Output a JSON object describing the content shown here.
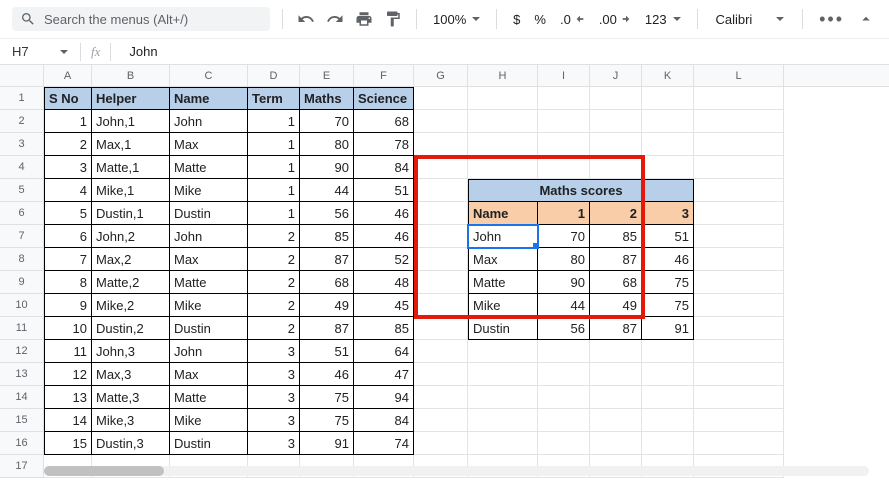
{
  "toolbar": {
    "search_placeholder": "Search the menus (Alt+/)",
    "zoom": "100%",
    "currency": "$",
    "percent": "%",
    "dec_dec": ".0",
    "inc_dec": ".00",
    "fmt123": "123",
    "font": "Calibri",
    "more": "•••"
  },
  "formula_bar": {
    "cell_ref": "H7",
    "fx": "fx",
    "value": "John"
  },
  "columns": [
    "A",
    "B",
    "C",
    "D",
    "E",
    "F",
    "G",
    "H",
    "I",
    "J",
    "K",
    "L"
  ],
  "main_headers": [
    "S No",
    "Helper",
    "Name",
    "Term",
    "Maths",
    "Science"
  ],
  "main_rows": [
    [
      "1",
      "John,1",
      "John",
      "1",
      "70",
      "68"
    ],
    [
      "2",
      "Max,1",
      "Max",
      "1",
      "80",
      "78"
    ],
    [
      "3",
      "Matte,1",
      "Matte",
      "1",
      "90",
      "84"
    ],
    [
      "4",
      "Mike,1",
      "Mike",
      "1",
      "44",
      "51"
    ],
    [
      "5",
      "Dustin,1",
      "Dustin",
      "1",
      "56",
      "46"
    ],
    [
      "6",
      "John,2",
      "John",
      "2",
      "85",
      "46"
    ],
    [
      "7",
      "Max,2",
      "Max",
      "2",
      "87",
      "52"
    ],
    [
      "8",
      "Matte,2",
      "Matte",
      "2",
      "68",
      "48"
    ],
    [
      "9",
      "Mike,2",
      "Mike",
      "2",
      "49",
      "45"
    ],
    [
      "10",
      "Dustin,2",
      "Dustin",
      "2",
      "87",
      "85"
    ],
    [
      "11",
      "John,3",
      "John",
      "3",
      "51",
      "64"
    ],
    [
      "12",
      "Max,3",
      "Max",
      "3",
      "46",
      "47"
    ],
    [
      "13",
      "Matte,3",
      "Matte",
      "3",
      "75",
      "94"
    ],
    [
      "14",
      "Mike,3",
      "Mike",
      "3",
      "75",
      "84"
    ],
    [
      "15",
      "Dustin,3",
      "Dustin",
      "3",
      "91",
      "74"
    ]
  ],
  "side_table": {
    "title": "Maths scores",
    "col_headers": [
      "Name",
      "1",
      "2",
      "3"
    ],
    "rows": [
      [
        "John",
        "70",
        "85",
        "51"
      ],
      [
        "Max",
        "80",
        "87",
        "46"
      ],
      [
        "Matte",
        "90",
        "68",
        "75"
      ],
      [
        "Mike",
        "44",
        "49",
        "75"
      ],
      [
        "Dustin",
        "56",
        "87",
        "91"
      ]
    ]
  },
  "chart_data": {
    "type": "table",
    "title": "Maths scores",
    "columns": [
      "Name",
      "Term 1",
      "Term 2",
      "Term 3"
    ],
    "rows": [
      {
        "Name": "John",
        "Term 1": 70,
        "Term 2": 85,
        "Term 3": 51
      },
      {
        "Name": "Max",
        "Term 1": 80,
        "Term 2": 87,
        "Term 3": 46
      },
      {
        "Name": "Matte",
        "Term 1": 90,
        "Term 2": 68,
        "Term 3": 75
      },
      {
        "Name": "Mike",
        "Term 1": 44,
        "Term 2": 49,
        "Term 3": 75
      },
      {
        "Name": "Dustin",
        "Term 1": 56,
        "Term 2": 87,
        "Term 3": 91
      }
    ]
  }
}
